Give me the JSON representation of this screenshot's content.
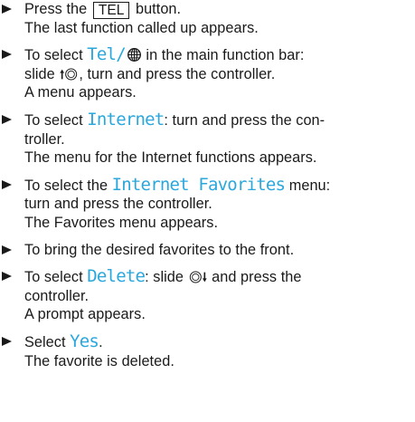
{
  "steps": [
    {
      "line1": {
        "before": "Press the",
        "key": "TEL",
        "after": "button."
      },
      "result": "The last function called up appears."
    },
    {
      "l1_before": "To select",
      "l1_disp": "Tel/",
      "l1_after": "in the main function bar:",
      "l2_before": "slide",
      "l2_after": ", turn and press the controller.",
      "result": "A menu appears.",
      "icons": [
        "globe-icon",
        "slide-up-controller-icon"
      ]
    },
    {
      "l1_before": "To select",
      "l1_disp": "Internet",
      "l1_after": ": turn and press the con-",
      "l2": "troller.",
      "result": "The menu for the Internet functions appears."
    },
    {
      "l1_before": "To select the",
      "l1_disp": "Internet Favorites",
      "l1_after": "menu:",
      "l2": "turn and press the controller.",
      "result": "The Favorites menu appears."
    },
    {
      "l1": "To bring the desired favorites to the front."
    },
    {
      "l1_before": "To select",
      "l1_disp": "Delete",
      "l1_mid": ": slide",
      "l1_after": "and press the",
      "l2": "controller.",
      "result": "A prompt appears.",
      "icons": [
        "slide-down-controller-icon"
      ]
    },
    {
      "l1_before": "Select",
      "l1_disp": "Yes",
      "l1_after": ".",
      "result": "The favorite is deleted."
    }
  ],
  "colors": {
    "text": "#1a1a1a",
    "display_text": "#2aa7dc"
  }
}
